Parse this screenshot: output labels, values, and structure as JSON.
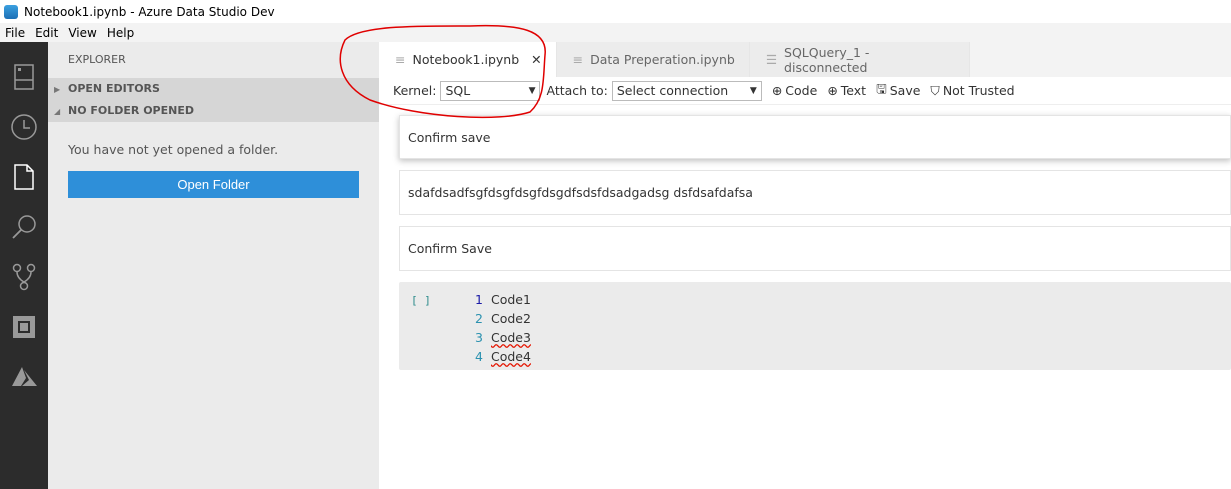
{
  "window": {
    "title": "Notebook1.ipynb - Azure Data Studio Dev"
  },
  "menu": [
    "File",
    "Edit",
    "View",
    "Help"
  ],
  "sidebar": {
    "title": "EXPLORER",
    "sections": [
      "OPEN EDITORS",
      "NO FOLDER OPENED"
    ],
    "message": "You have not yet opened a folder.",
    "open_folder": "Open Folder"
  },
  "tabs": [
    {
      "label": "Notebook1.ipynb",
      "close": "✕"
    },
    {
      "label": "Data Preperation.ipynb"
    },
    {
      "label": "SQLQuery_1 - disconnected"
    }
  ],
  "toolbar": {
    "kernel_label": "Kernel:",
    "kernel_value": "SQL",
    "attach_label": "Attach to:",
    "attach_value": "Select connection",
    "code": "Code",
    "text": "Text",
    "save": "Save",
    "trusted": "Not Trusted"
  },
  "cells": [
    "Confirm save",
    "sdafdsadfsgfdsgfdsgfdsgdfsdsfdsadgadsg dsfdsafdafsa",
    "Confirm Save"
  ],
  "code_cell": {
    "bracket": "[ ]",
    "lines": [
      {
        "n": "1",
        "code": "Code1"
      },
      {
        "n": "2",
        "code": "Code2"
      },
      {
        "n": "3",
        "code": "Code3"
      },
      {
        "n": "4",
        "code": "Code4"
      }
    ]
  },
  "colors": {
    "accent": "#2e8fd9",
    "annotation": "#e00000"
  }
}
